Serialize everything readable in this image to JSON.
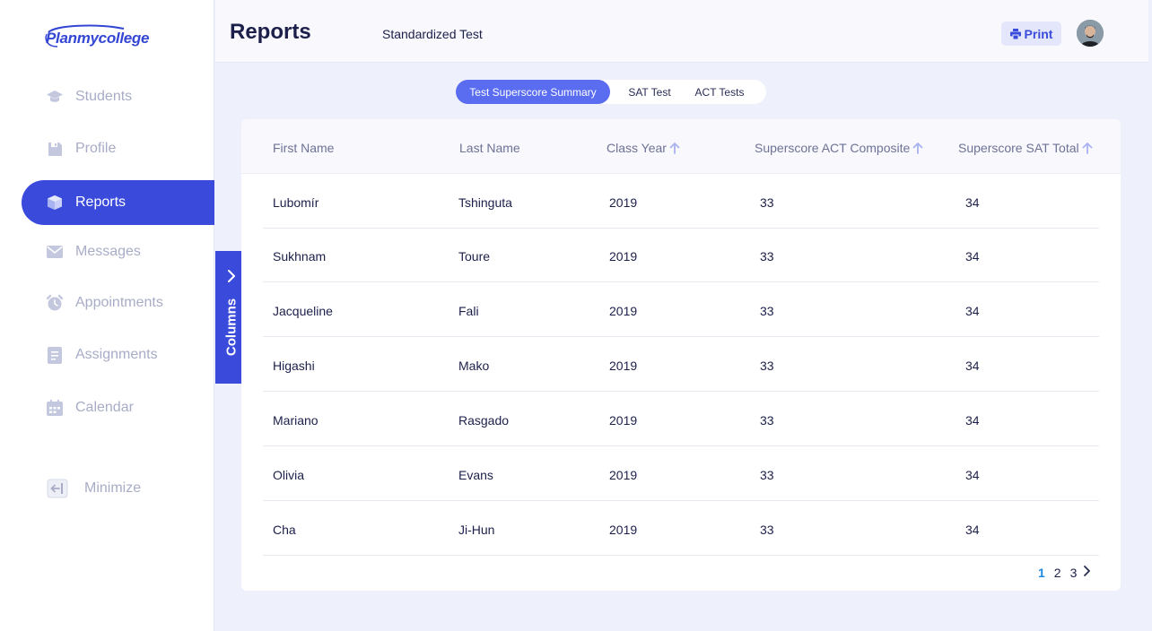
{
  "brand": {
    "name": "Planmycollege"
  },
  "sidebar": {
    "items": [
      {
        "label": "Students",
        "icon": "graduation-cap-icon"
      },
      {
        "label": "Profile",
        "icon": "save-icon"
      },
      {
        "label": "Reports",
        "icon": "cube-icon",
        "active": true
      },
      {
        "label": "Messages",
        "icon": "envelope-icon"
      },
      {
        "label": "Appointments",
        "icon": "alarm-clock-icon"
      },
      {
        "label": "Assignments",
        "icon": "document-icon"
      },
      {
        "label": "Calendar",
        "icon": "calendar-icon"
      }
    ],
    "minimize_label": "Minimize"
  },
  "columns_tab": {
    "label": "Columns"
  },
  "header": {
    "title": "Reports",
    "subtitle": "Standardized Test",
    "print_label": "Print"
  },
  "tabs": [
    {
      "label": "Test Superscore Summary",
      "active": true
    },
    {
      "label": "SAT Test"
    },
    {
      "label": "ACT Tests"
    }
  ],
  "table": {
    "columns": [
      "First Name",
      "Last Name",
      "Class Year",
      "Superscore ACT Composite",
      "Superscore SAT Total"
    ],
    "rows": [
      [
        "Lubomír",
        "Tshinguta",
        "2019",
        "33",
        "34"
      ],
      [
        "Sukhnam",
        "Toure",
        "2019",
        "33",
        "34"
      ],
      [
        "Jacqueline",
        "Fali",
        "2019",
        "33",
        "34"
      ],
      [
        "Higashi",
        "Mako",
        "2019",
        "33",
        "34"
      ],
      [
        "Mariano",
        "Rasgado",
        "2019",
        "33",
        "34"
      ],
      [
        "Olivia",
        "Evans",
        "2019",
        "33",
        "34"
      ],
      [
        "Cha",
        "Ji-Hun",
        "2019",
        "33",
        "34"
      ]
    ]
  },
  "pagination": {
    "pages": [
      "1",
      "2",
      "3"
    ],
    "current": "1"
  },
  "colors": {
    "accent": "#3a4bdb",
    "tab_active": "#5a6cf0",
    "page_current": "#1e8ae0",
    "nav_muted": "#a8acc6"
  }
}
